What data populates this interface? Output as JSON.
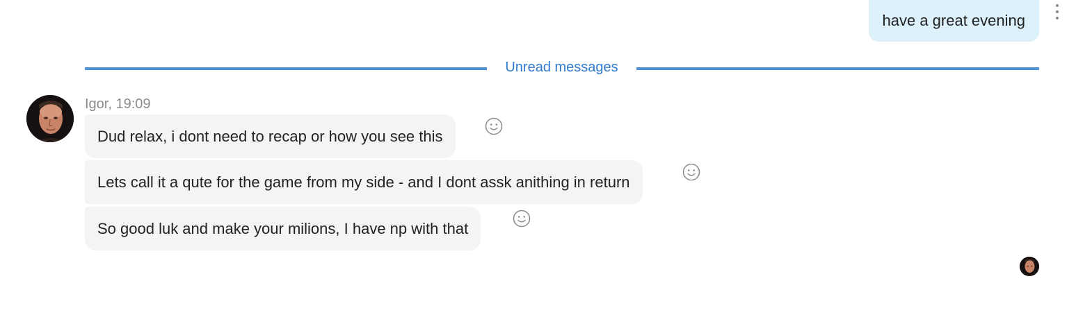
{
  "outgoing": {
    "text": "have a great evening"
  },
  "divider": {
    "label": "Unread messages",
    "color": "#4d8fd4"
  },
  "incoming": {
    "sender": "Igor, 19:09",
    "messages": [
      {
        "text": "Dud relax, i dont need to recap or how you see this"
      },
      {
        "text": "Lets call it a qute for the game from my side - and I dont assk anithing in return"
      },
      {
        "text": "So good luk and make your milions, I have np with that"
      }
    ]
  },
  "icons": {
    "more": "more-options-icon",
    "react": "smiley-icon",
    "avatar": "avatar",
    "read_receipt": "read-receipt-avatar"
  },
  "colors": {
    "outgoing_bubble": "#ddf1fb",
    "incoming_bubble": "#f2f4f6",
    "accent": "#2f7bcd"
  }
}
